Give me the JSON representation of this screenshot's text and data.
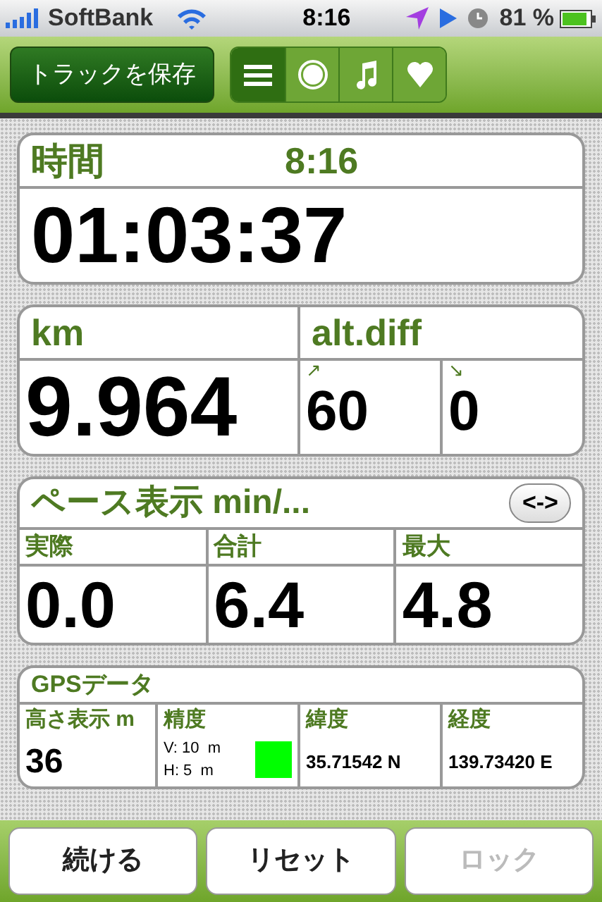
{
  "status_bar": {
    "carrier": "SoftBank",
    "time": "8:16",
    "battery": "81 %"
  },
  "toolbar": {
    "save_button": "トラックを保存",
    "segments": [
      {
        "kind": "list",
        "selected": true
      },
      {
        "kind": "record",
        "selected": false
      },
      {
        "kind": "music",
        "selected": false
      },
      {
        "kind": "heart",
        "selected": false
      }
    ]
  },
  "time_card": {
    "label": "時間",
    "clock": "8:16",
    "value": "01:03:37"
  },
  "distance_card": {
    "label": "km",
    "value": "9.964",
    "alt_label": "alt.diff",
    "up_arrow": "↗",
    "up": "60",
    "down_arrow": "↘",
    "down": "0"
  },
  "pace_card": {
    "title": "ペース表示 min/...",
    "toggle": "<->",
    "columns": [
      {
        "label": "実際",
        "value": "0.0"
      },
      {
        "label": "合計",
        "value": "6.4"
      },
      {
        "label": "最大",
        "value": "4.8"
      }
    ]
  },
  "gps_card": {
    "title": "GPSデータ",
    "altitude_label": "高さ表示 m",
    "altitude": "36",
    "accuracy_label": "精度",
    "vertical": "V: 10  m",
    "horizontal": "H: 5  m",
    "accuracy_indicator": {
      "color": "#00ff00"
    },
    "latitude_label": "緯度",
    "latitude": "35.71542 N",
    "longitude_label": "経度",
    "longitude": "139.73420 E"
  },
  "buttons": [
    {
      "label": "続ける",
      "disabled": false
    },
    {
      "label": "リセット",
      "disabled": false
    },
    {
      "label": "ロック",
      "disabled": true
    }
  ]
}
